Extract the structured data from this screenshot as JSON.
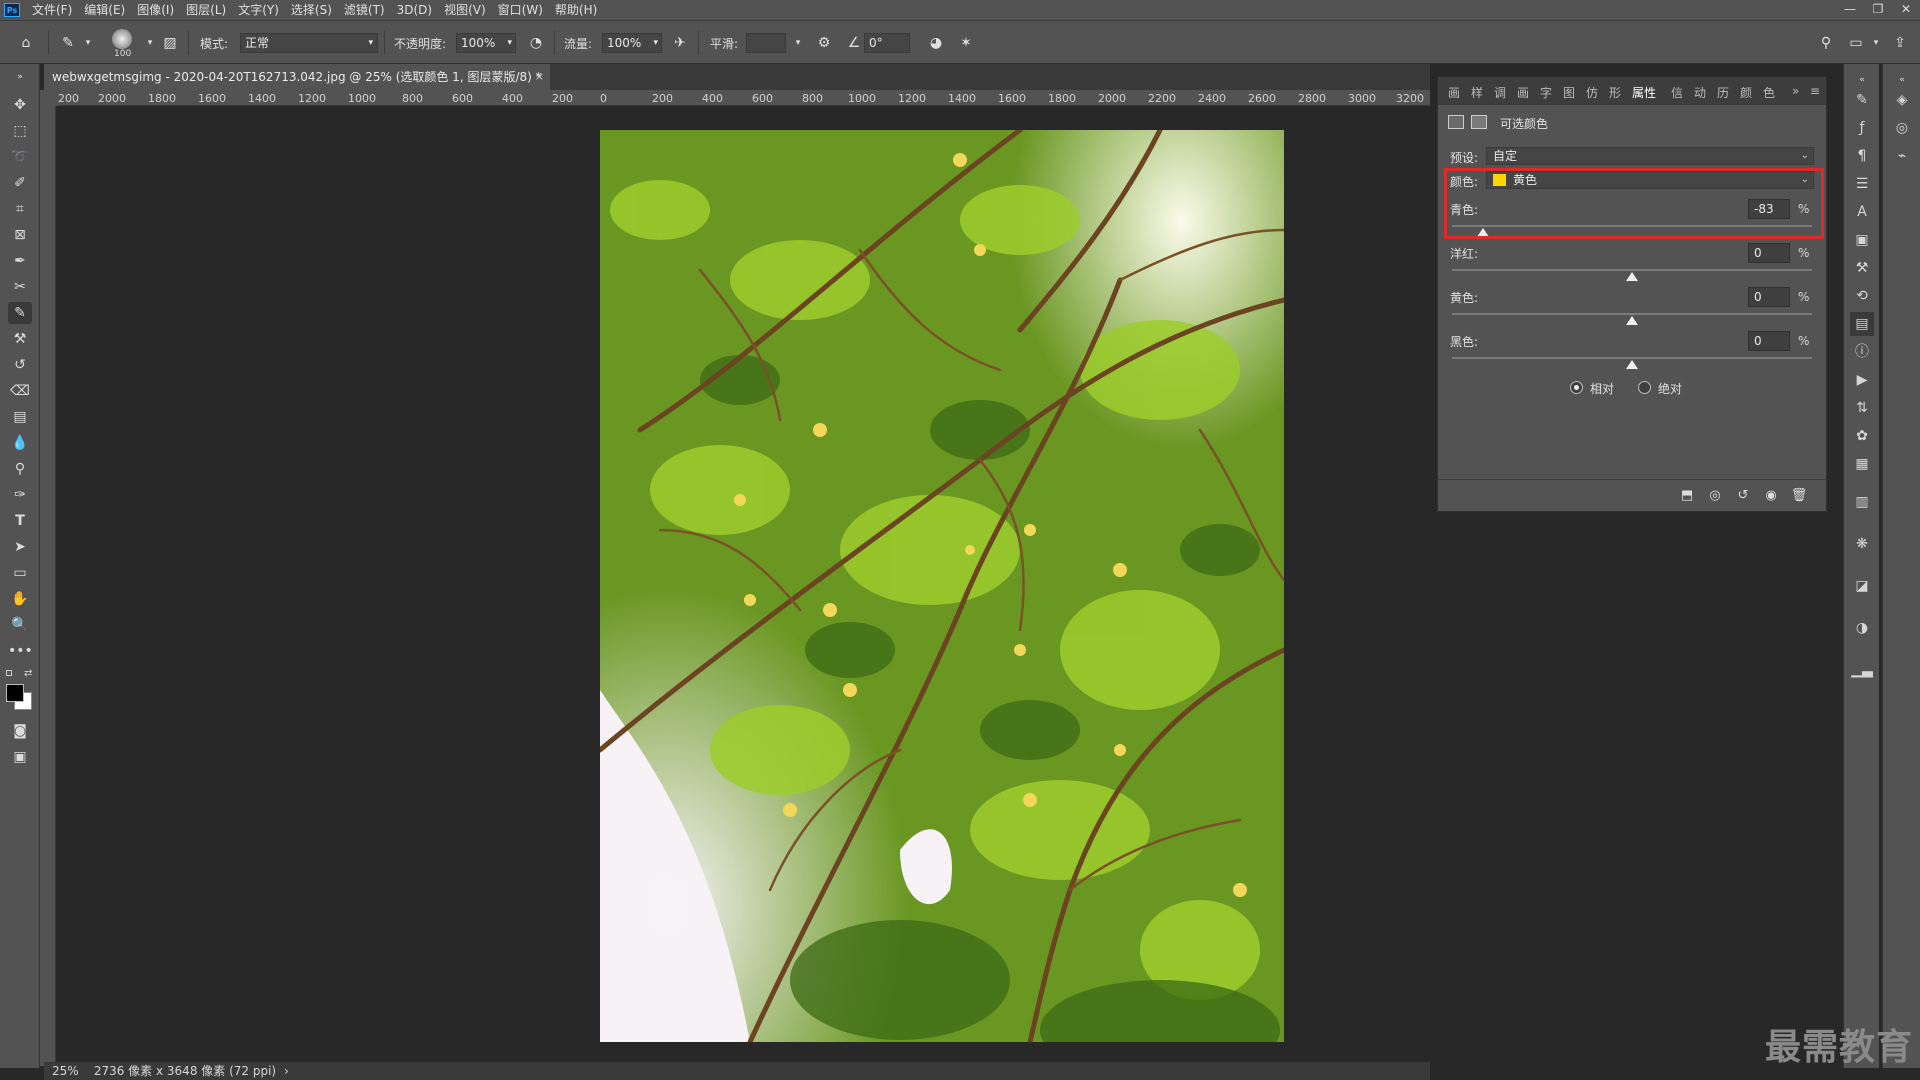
{
  "app": {
    "logo": "Ps",
    "menu": [
      "文件(F)",
      "编辑(E)",
      "图像(I)",
      "图层(L)",
      "文字(Y)",
      "选择(S)",
      "滤镜(T)",
      "3D(D)",
      "视图(V)",
      "窗口(W)",
      "帮助(H)"
    ],
    "window_controls": [
      "—",
      "❐",
      "✕"
    ]
  },
  "options": {
    "brush_size": "100",
    "mode_label": "模式:",
    "mode_value": "正常",
    "opacity_label": "不透明度:",
    "opacity_value": "100%",
    "flow_label": "流量:",
    "flow_value": "100%",
    "smooth_label": "平滑:",
    "smooth_value": "",
    "angle_value": "0°"
  },
  "document": {
    "tab_title": "webwxgetmsgimg - 2020-04-20T162713.042.jpg @ 25% (选取颜色 1, 图层蒙版/8) *",
    "close": "×"
  },
  "ruler": {
    "h_ticks": [
      "200",
      "2000",
      "1800",
      "1600",
      "1400",
      "1200",
      "1000",
      "800",
      "600",
      "400",
      "200",
      "0",
      "200",
      "400",
      "600",
      "800",
      "1000",
      "1200",
      "1400",
      "1600",
      "1800",
      "2000",
      "2200",
      "2400",
      "2600",
      "2800",
      "3000",
      "3200"
    ]
  },
  "panel": {
    "tabs": [
      "画",
      "样",
      "调",
      "画",
      "字",
      "图",
      "仿",
      "形",
      "属性",
      "信",
      "动",
      "历",
      "颜",
      "色"
    ],
    "active_tab": "属性",
    "title": "可选颜色",
    "preset_label": "预设:",
    "preset_value": "自定",
    "color_label": "颜色:",
    "color_value": "黄色",
    "color_swatch": "#ffd400",
    "sliders": [
      {
        "label": "青色:",
        "value": "-83",
        "unit": "%",
        "level": -83
      },
      {
        "label": "洋红:",
        "value": "0",
        "unit": "%",
        "level": 0
      },
      {
        "label": "黄色:",
        "value": "0",
        "unit": "%",
        "level": 0
      },
      {
        "label": "黑色:",
        "value": "0",
        "unit": "%",
        "level": 0
      }
    ],
    "method_relative": "相对",
    "method_absolute": "绝对",
    "selected_method": "相对",
    "highlight_color": "#e02a2a"
  },
  "status": {
    "zoom": "25%",
    "info": "2736 像素 x 3648 像素 (72 ppi)"
  },
  "watermark": "最需教育"
}
